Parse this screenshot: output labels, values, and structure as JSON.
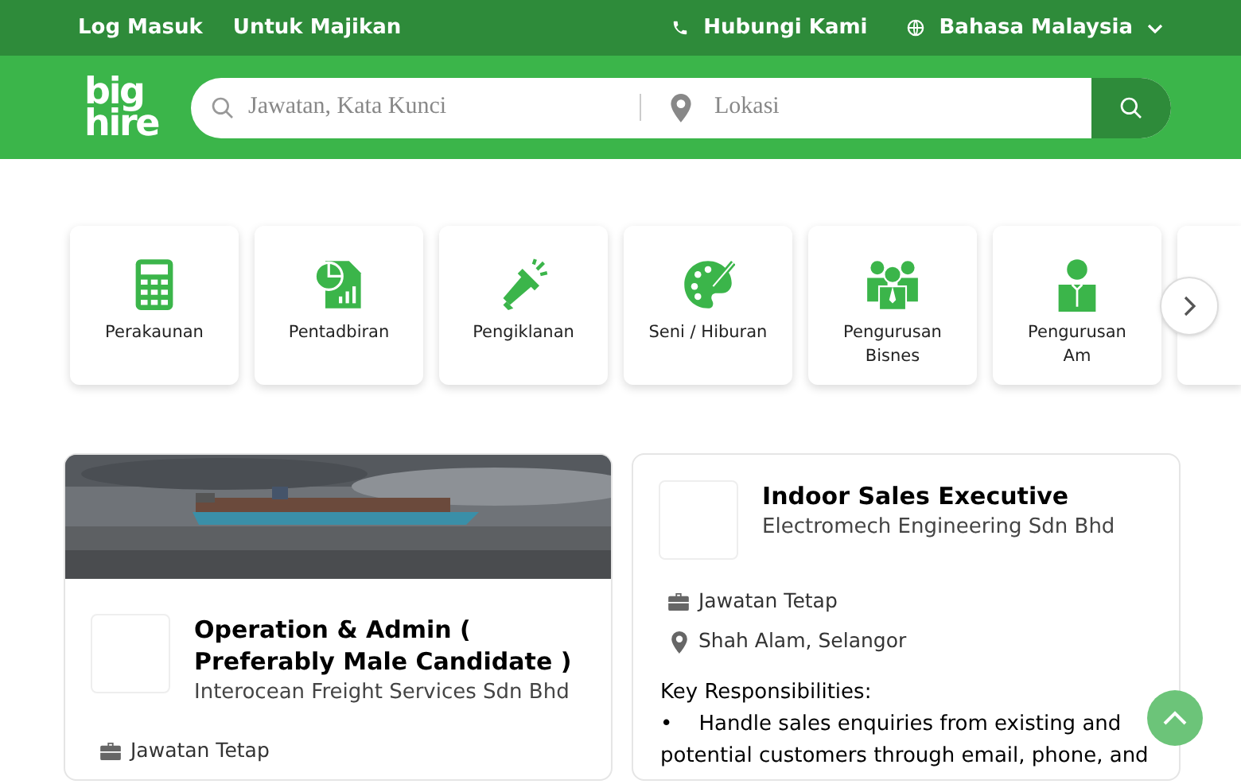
{
  "top_bar": {
    "links": [
      "Log Masuk",
      "Untuk Majikan"
    ],
    "contact": "Hubungi Kami",
    "language": "Bahasa Malaysia"
  },
  "header": {
    "logo": [
      "big",
      "hire"
    ],
    "search": {
      "keyword_placeholder": "Jawatan, Kata Kunci",
      "location_placeholder": "Lokasi"
    }
  },
  "categories": [
    {
      "kind": "calculator",
      "label": "Perakaunan"
    },
    {
      "kind": "report",
      "label": "Pentadbiran"
    },
    {
      "kind": "megaphone",
      "label": "Pengiklanan"
    },
    {
      "kind": "palette",
      "label": "Seni / Hiburan"
    },
    {
      "kind": "group",
      "label": "Pengurusan Bisnes"
    },
    {
      "kind": "person",
      "label": "Pengurusan Am"
    }
  ],
  "jobs": [
    {
      "kind": "picture",
      "title": "Operation & Admin ( Preferably Male Candidate )",
      "company": "Interocean Freight Services Sdn Bhd",
      "type": "Jawatan Tetap"
    },
    {
      "title": "Indoor Sales Executive",
      "company": "Electromech Engineering Sdn Bhd",
      "type": "Jawatan Tetap",
      "location": "Shah Alam, Selangor",
      "description": [
        "Key Responsibilities:",
        "•    Handle sales enquiries from existing and potential customers through email, phone, and"
      ]
    }
  ]
}
